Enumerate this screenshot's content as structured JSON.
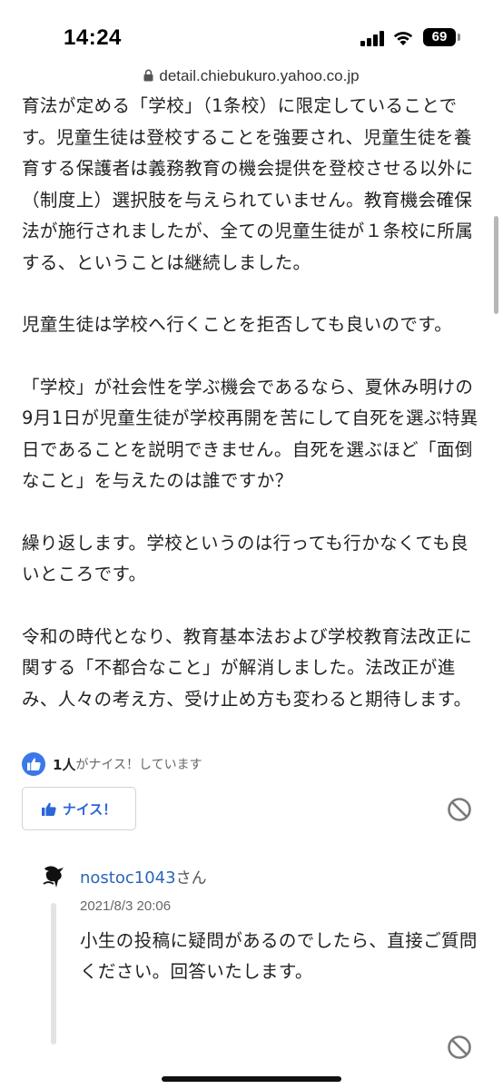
{
  "status_bar": {
    "time": "14:24",
    "battery": "69"
  },
  "browser": {
    "url": "detail.chiebukuro.yahoo.co.jp"
  },
  "answer": {
    "paragraphs": [
      "育法が定める「学校」（1条校）に限定していることです。児童生徒は登校することを強要され、児童生徒を養育する保護者は義務教育の機会提供を登校させる以外に（制度上）選択肢を与えられていません。教育機会確保法が施行されましたが、全ての児童生徒が１条校に所属する、ということは継続しました。",
      "児童生徒は学校へ行くことを拒否しても良いのです。",
      "「学校」が社会性を学ぶ機会であるなら、夏休み明けの9月1日が児童生徒が学校再開を苦にして自死を選ぶ特異日であることを説明できません。自死を選ぶほど「面倒なこと」を与えたのは誰ですか？",
      "繰り返します。学校というのは行っても行かなくても良いところです。",
      "令和の時代となり、教育基本法および学校教育法改正に関する「不都合なこと」が解消しました。法改正が進み、人々の考え方、受け止め方も変わると期待します。"
    ]
  },
  "reactions": {
    "count": "1人",
    "text": "がナイス！しています",
    "nice_button_label": "ナイス！"
  },
  "reply": {
    "username": "nostoc1043",
    "honorific": "さん",
    "date": "2021/8/3 20:06",
    "text": "小生の投稿に疑問があるのでしたら、直接ご質問ください。回答いたします。"
  },
  "colors": {
    "accent_blue": "#3a78e8",
    "link_blue": "#2b66b8",
    "text": "#222222"
  }
}
